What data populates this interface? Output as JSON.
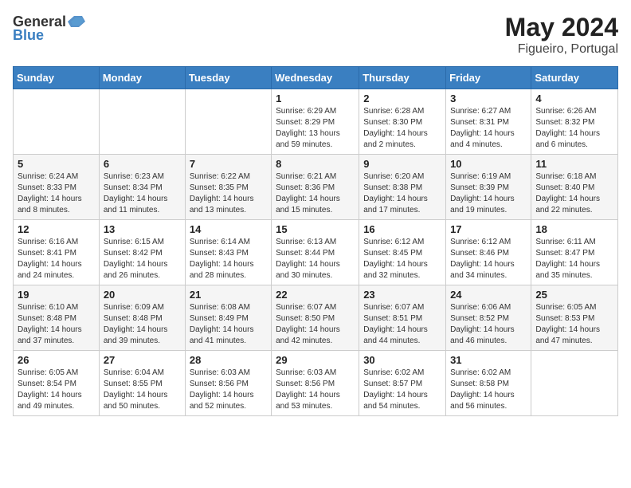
{
  "logo": {
    "general": "General",
    "blue": "Blue"
  },
  "title": "May 2024",
  "location": "Figueiro, Portugal",
  "days_of_week": [
    "Sunday",
    "Monday",
    "Tuesday",
    "Wednesday",
    "Thursday",
    "Friday",
    "Saturday"
  ],
  "weeks": [
    [
      {
        "day": "",
        "sunrise": "",
        "sunset": "",
        "daylight": ""
      },
      {
        "day": "",
        "sunrise": "",
        "sunset": "",
        "daylight": ""
      },
      {
        "day": "",
        "sunrise": "",
        "sunset": "",
        "daylight": ""
      },
      {
        "day": "1",
        "sunrise": "Sunrise: 6:29 AM",
        "sunset": "Sunset: 8:29 PM",
        "daylight": "Daylight: 13 hours and 59 minutes."
      },
      {
        "day": "2",
        "sunrise": "Sunrise: 6:28 AM",
        "sunset": "Sunset: 8:30 PM",
        "daylight": "Daylight: 14 hours and 2 minutes."
      },
      {
        "day": "3",
        "sunrise": "Sunrise: 6:27 AM",
        "sunset": "Sunset: 8:31 PM",
        "daylight": "Daylight: 14 hours and 4 minutes."
      },
      {
        "day": "4",
        "sunrise": "Sunrise: 6:26 AM",
        "sunset": "Sunset: 8:32 PM",
        "daylight": "Daylight: 14 hours and 6 minutes."
      }
    ],
    [
      {
        "day": "5",
        "sunrise": "Sunrise: 6:24 AM",
        "sunset": "Sunset: 8:33 PM",
        "daylight": "Daylight: 14 hours and 8 minutes."
      },
      {
        "day": "6",
        "sunrise": "Sunrise: 6:23 AM",
        "sunset": "Sunset: 8:34 PM",
        "daylight": "Daylight: 14 hours and 11 minutes."
      },
      {
        "day": "7",
        "sunrise": "Sunrise: 6:22 AM",
        "sunset": "Sunset: 8:35 PM",
        "daylight": "Daylight: 14 hours and 13 minutes."
      },
      {
        "day": "8",
        "sunrise": "Sunrise: 6:21 AM",
        "sunset": "Sunset: 8:36 PM",
        "daylight": "Daylight: 14 hours and 15 minutes."
      },
      {
        "day": "9",
        "sunrise": "Sunrise: 6:20 AM",
        "sunset": "Sunset: 8:38 PM",
        "daylight": "Daylight: 14 hours and 17 minutes."
      },
      {
        "day": "10",
        "sunrise": "Sunrise: 6:19 AM",
        "sunset": "Sunset: 8:39 PM",
        "daylight": "Daylight: 14 hours and 19 minutes."
      },
      {
        "day": "11",
        "sunrise": "Sunrise: 6:18 AM",
        "sunset": "Sunset: 8:40 PM",
        "daylight": "Daylight: 14 hours and 22 minutes."
      }
    ],
    [
      {
        "day": "12",
        "sunrise": "Sunrise: 6:16 AM",
        "sunset": "Sunset: 8:41 PM",
        "daylight": "Daylight: 14 hours and 24 minutes."
      },
      {
        "day": "13",
        "sunrise": "Sunrise: 6:15 AM",
        "sunset": "Sunset: 8:42 PM",
        "daylight": "Daylight: 14 hours and 26 minutes."
      },
      {
        "day": "14",
        "sunrise": "Sunrise: 6:14 AM",
        "sunset": "Sunset: 8:43 PM",
        "daylight": "Daylight: 14 hours and 28 minutes."
      },
      {
        "day": "15",
        "sunrise": "Sunrise: 6:13 AM",
        "sunset": "Sunset: 8:44 PM",
        "daylight": "Daylight: 14 hours and 30 minutes."
      },
      {
        "day": "16",
        "sunrise": "Sunrise: 6:12 AM",
        "sunset": "Sunset: 8:45 PM",
        "daylight": "Daylight: 14 hours and 32 minutes."
      },
      {
        "day": "17",
        "sunrise": "Sunrise: 6:12 AM",
        "sunset": "Sunset: 8:46 PM",
        "daylight": "Daylight: 14 hours and 34 minutes."
      },
      {
        "day": "18",
        "sunrise": "Sunrise: 6:11 AM",
        "sunset": "Sunset: 8:47 PM",
        "daylight": "Daylight: 14 hours and 35 minutes."
      }
    ],
    [
      {
        "day": "19",
        "sunrise": "Sunrise: 6:10 AM",
        "sunset": "Sunset: 8:48 PM",
        "daylight": "Daylight: 14 hours and 37 minutes."
      },
      {
        "day": "20",
        "sunrise": "Sunrise: 6:09 AM",
        "sunset": "Sunset: 8:48 PM",
        "daylight": "Daylight: 14 hours and 39 minutes."
      },
      {
        "day": "21",
        "sunrise": "Sunrise: 6:08 AM",
        "sunset": "Sunset: 8:49 PM",
        "daylight": "Daylight: 14 hours and 41 minutes."
      },
      {
        "day": "22",
        "sunrise": "Sunrise: 6:07 AM",
        "sunset": "Sunset: 8:50 PM",
        "daylight": "Daylight: 14 hours and 42 minutes."
      },
      {
        "day": "23",
        "sunrise": "Sunrise: 6:07 AM",
        "sunset": "Sunset: 8:51 PM",
        "daylight": "Daylight: 14 hours and 44 minutes."
      },
      {
        "day": "24",
        "sunrise": "Sunrise: 6:06 AM",
        "sunset": "Sunset: 8:52 PM",
        "daylight": "Daylight: 14 hours and 46 minutes."
      },
      {
        "day": "25",
        "sunrise": "Sunrise: 6:05 AM",
        "sunset": "Sunset: 8:53 PM",
        "daylight": "Daylight: 14 hours and 47 minutes."
      }
    ],
    [
      {
        "day": "26",
        "sunrise": "Sunrise: 6:05 AM",
        "sunset": "Sunset: 8:54 PM",
        "daylight": "Daylight: 14 hours and 49 minutes."
      },
      {
        "day": "27",
        "sunrise": "Sunrise: 6:04 AM",
        "sunset": "Sunset: 8:55 PM",
        "daylight": "Daylight: 14 hours and 50 minutes."
      },
      {
        "day": "28",
        "sunrise": "Sunrise: 6:03 AM",
        "sunset": "Sunset: 8:56 PM",
        "daylight": "Daylight: 14 hours and 52 minutes."
      },
      {
        "day": "29",
        "sunrise": "Sunrise: 6:03 AM",
        "sunset": "Sunset: 8:56 PM",
        "daylight": "Daylight: 14 hours and 53 minutes."
      },
      {
        "day": "30",
        "sunrise": "Sunrise: 6:02 AM",
        "sunset": "Sunset: 8:57 PM",
        "daylight": "Daylight: 14 hours and 54 minutes."
      },
      {
        "day": "31",
        "sunrise": "Sunrise: 6:02 AM",
        "sunset": "Sunset: 8:58 PM",
        "daylight": "Daylight: 14 hours and 56 minutes."
      },
      {
        "day": "",
        "sunrise": "",
        "sunset": "",
        "daylight": ""
      }
    ]
  ]
}
